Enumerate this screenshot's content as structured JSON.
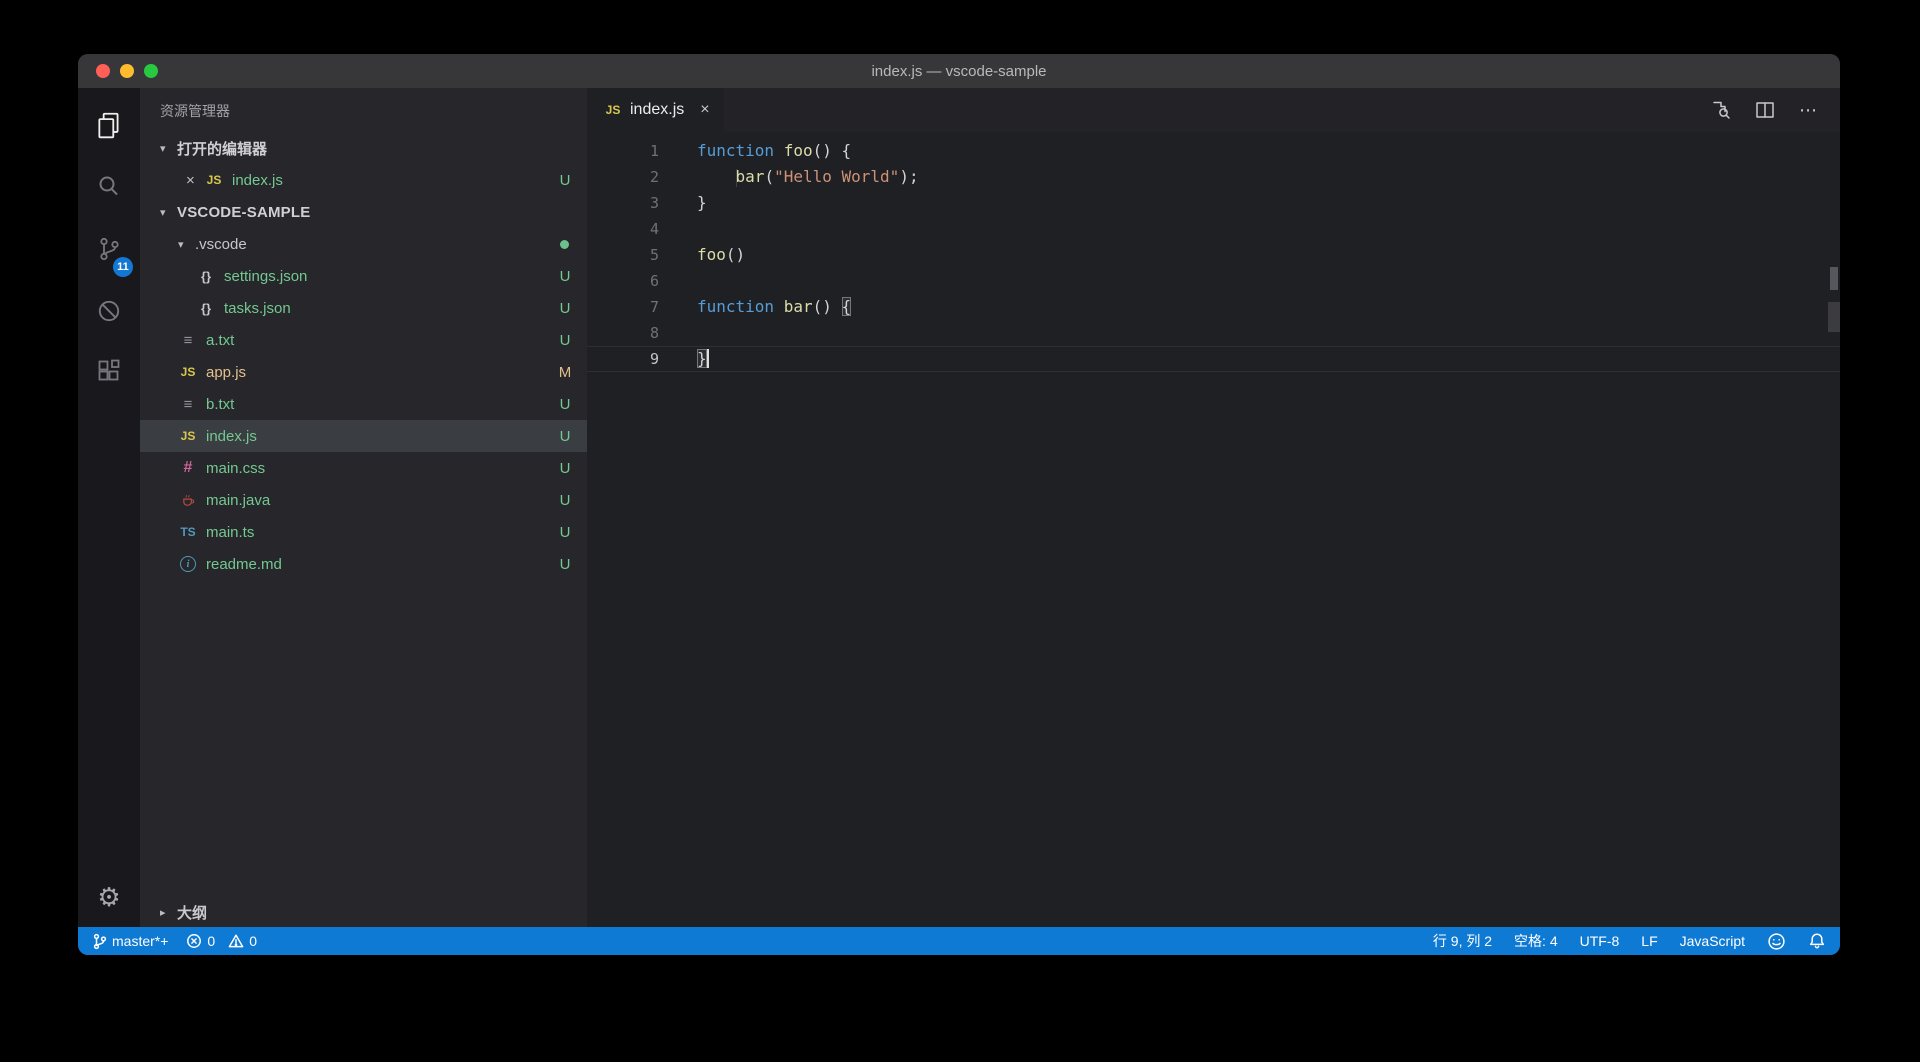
{
  "window": {
    "title": "index.js — vscode-sample"
  },
  "glyphs": {
    "expanded": "▾",
    "collapsed": "▸",
    "close": "×",
    "more": "⋯",
    "gear": "⚙"
  },
  "icon_glyphs": {
    "js": "JS",
    "ts": "TS",
    "json": "{}",
    "txt": "≡",
    "css": "#",
    "info": "i"
  },
  "activity_bar": {
    "items": [
      {
        "name": "explorer",
        "active": true
      },
      {
        "name": "search",
        "active": false
      },
      {
        "name": "source-control",
        "active": false,
        "badge": "11"
      },
      {
        "name": "debug",
        "active": false
      },
      {
        "name": "extensions",
        "active": false
      }
    ]
  },
  "sidebar": {
    "title": "资源管理器",
    "open_editors": {
      "label": "打开的编辑器",
      "files": [
        {
          "label": "index.js",
          "icon": "js",
          "status": "U",
          "color": "untracked"
        }
      ]
    },
    "root_label": "VSCODE-SAMPLE",
    "tree": [
      {
        "label": ".vscode",
        "indent": 1,
        "folder": true,
        "expanded": true,
        "color": "plain",
        "dot": true
      },
      {
        "label": "settings.json",
        "indent": 2,
        "icon": "json",
        "status": "U",
        "color": "untracked"
      },
      {
        "label": "tasks.json",
        "indent": 2,
        "icon": "json",
        "status": "U",
        "color": "untracked"
      },
      {
        "label": "a.txt",
        "indent": 1,
        "icon": "txt",
        "status": "U",
        "color": "untracked"
      },
      {
        "label": "app.js",
        "indent": 1,
        "icon": "js",
        "status": "M",
        "color": "modified"
      },
      {
        "label": "b.txt",
        "indent": 1,
        "icon": "txt",
        "status": "U",
        "color": "untracked"
      },
      {
        "label": "index.js",
        "indent": 1,
        "icon": "js",
        "status": "U",
        "color": "untracked",
        "selected": true
      },
      {
        "label": "main.css",
        "indent": 1,
        "icon": "css",
        "status": "U",
        "color": "untracked"
      },
      {
        "label": "main.java",
        "indent": 1,
        "icon": "java",
        "status": "U",
        "color": "untracked"
      },
      {
        "label": "main.ts",
        "indent": 1,
        "icon": "ts",
        "status": "U",
        "color": "untracked"
      },
      {
        "label": "readme.md",
        "indent": 1,
        "icon": "info",
        "status": "U",
        "color": "untracked"
      }
    ],
    "outline": {
      "label": "大纲"
    }
  },
  "editor": {
    "tab": {
      "label": "index.js",
      "icon": "js"
    },
    "code": [
      {
        "num": "1",
        "tokens": [
          {
            "t": "k",
            "v": "function "
          },
          {
            "t": "f",
            "v": "foo"
          },
          {
            "t": "p",
            "v": "() {"
          }
        ]
      },
      {
        "num": "2",
        "tokens": [
          {
            "t": "p",
            "v": "    "
          },
          {
            "t": "g"
          },
          {
            "t": "f",
            "v": "bar"
          },
          {
            "t": "p",
            "v": "("
          },
          {
            "t": "s",
            "v": "\"Hello World\""
          },
          {
            "t": "p",
            "v": ");"
          }
        ]
      },
      {
        "num": "3",
        "tokens": [
          {
            "t": "p",
            "v": "}"
          }
        ]
      },
      {
        "num": "4",
        "tokens": []
      },
      {
        "num": "5",
        "tokens": [
          {
            "t": "f",
            "v": "foo"
          },
          {
            "t": "p",
            "v": "()"
          }
        ]
      },
      {
        "num": "6",
        "tokens": []
      },
      {
        "num": "7",
        "tokens": [
          {
            "t": "k",
            "v": "function "
          },
          {
            "t": "f",
            "v": "bar"
          },
          {
            "t": "p",
            "v": "() "
          },
          {
            "t": "p",
            "v": "{",
            "match": true
          }
        ]
      },
      {
        "num": "8",
        "tokens": []
      },
      {
        "num": "9",
        "tokens": [
          {
            "t": "p",
            "v": "}",
            "match": true
          }
        ],
        "current": true,
        "cursor": true
      }
    ]
  },
  "status_bar": {
    "branch": "master*+",
    "errors": "0",
    "warnings": "0",
    "right": [
      {
        "name": "cursor-position",
        "label": "行 9, 列 2"
      },
      {
        "name": "indentation",
        "label": "空格: 4"
      },
      {
        "name": "encoding",
        "label": "UTF-8"
      },
      {
        "name": "eol",
        "label": "LF"
      },
      {
        "name": "language-mode",
        "label": "JavaScript"
      }
    ]
  },
  "colors": {
    "accent": "#0e7ad3",
    "untracked": "#73c991",
    "modified": "#e2c08d"
  }
}
